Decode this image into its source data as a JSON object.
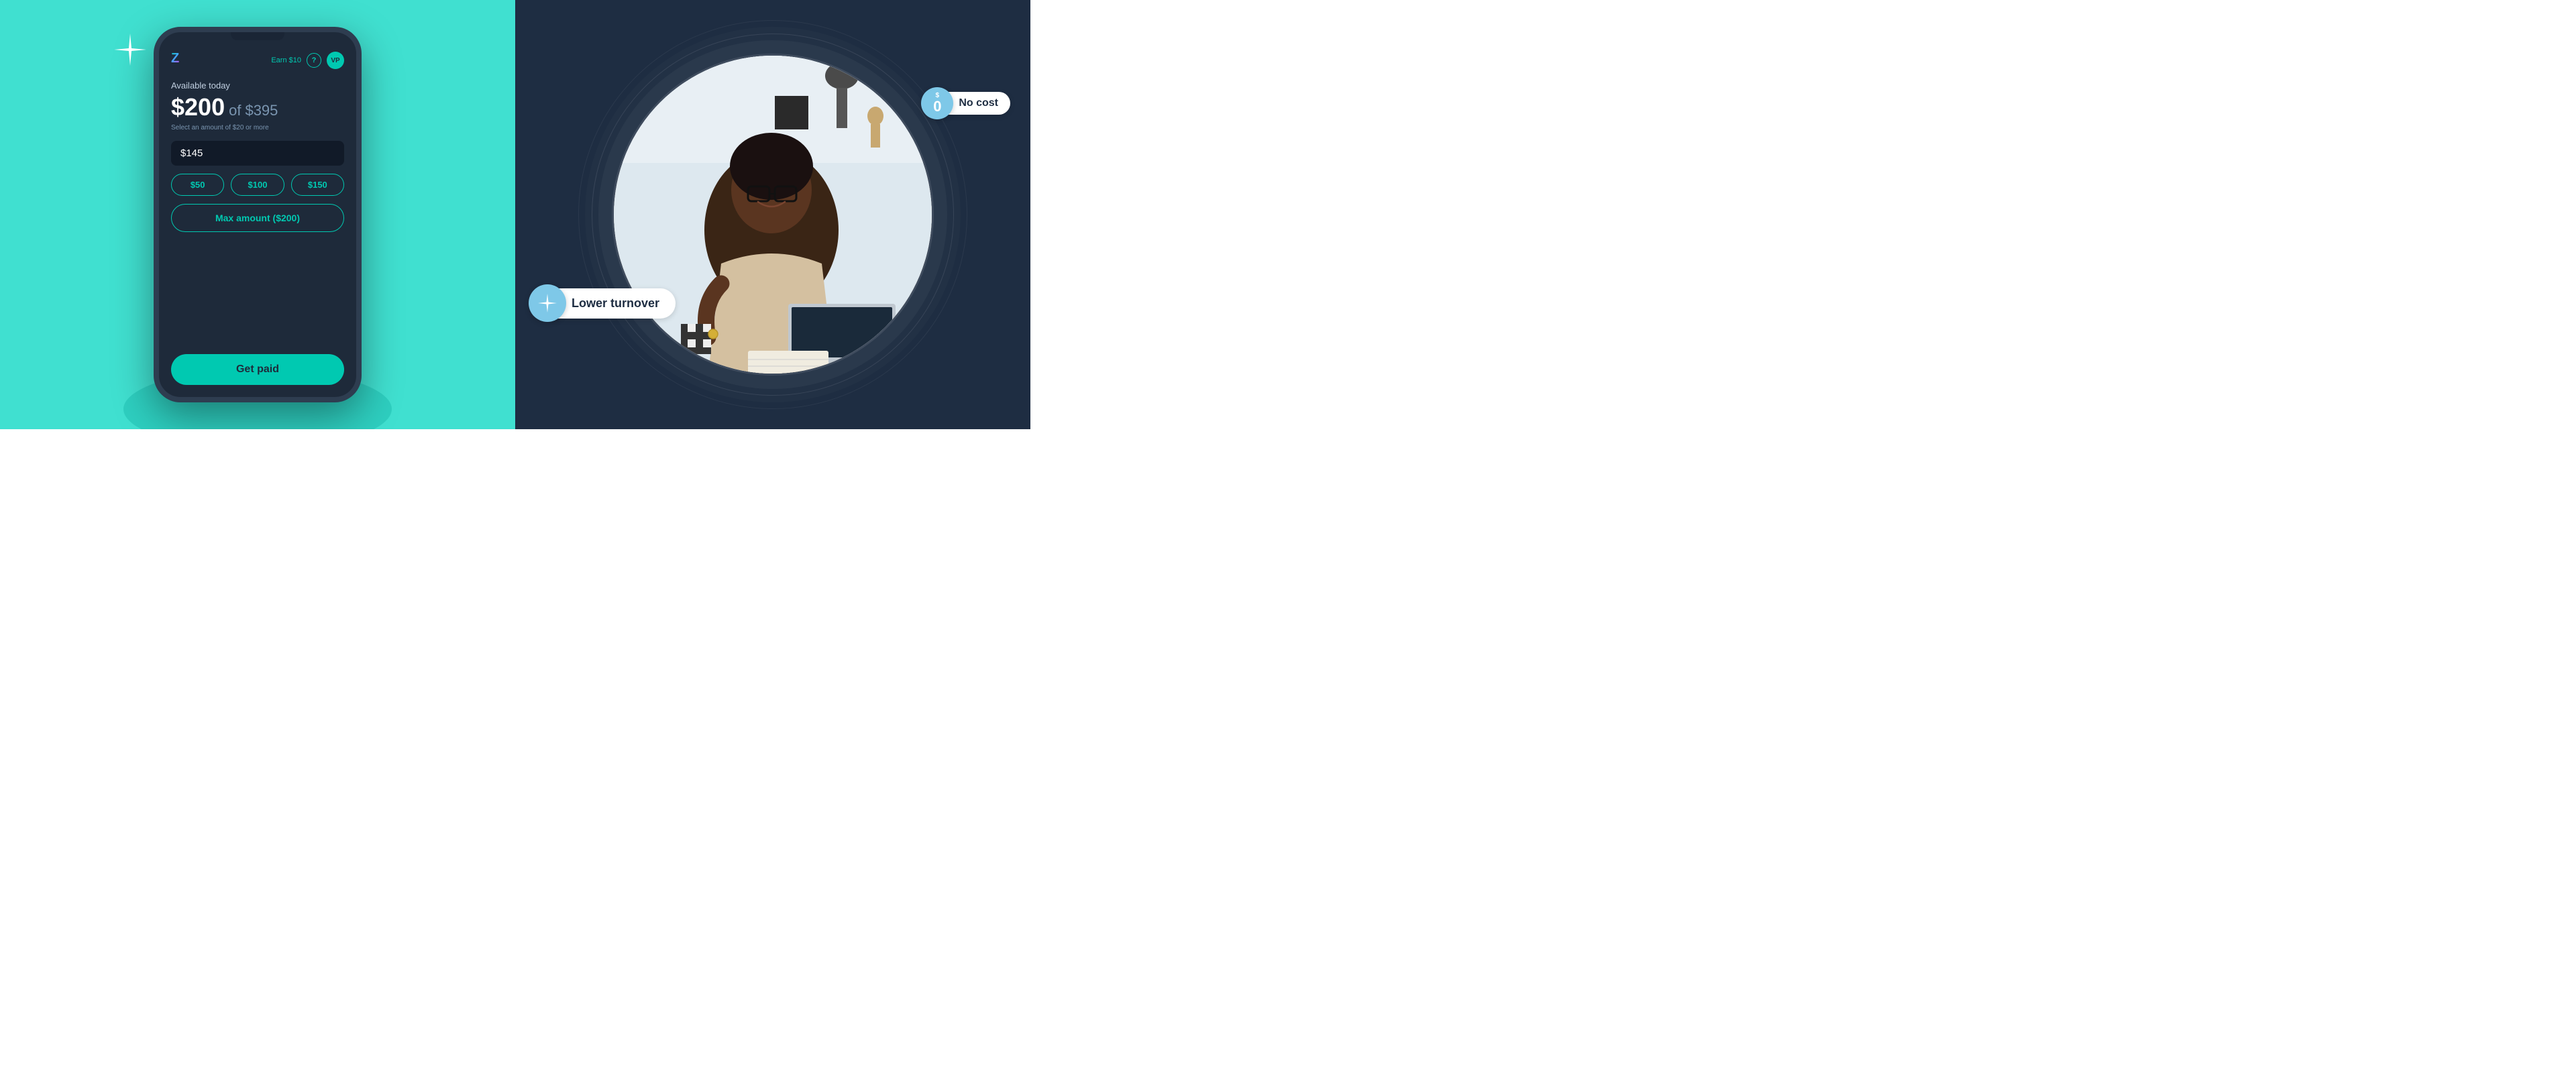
{
  "left_panel": {
    "bg_color": "#40E0D0",
    "phone": {
      "logo_text": "Z",
      "earn_label": "Earn $10",
      "help_label": "?",
      "avatar_initials": "VP",
      "available_label": "Available today",
      "amount_main": "$200",
      "amount_separator": "of",
      "amount_total": "$395",
      "select_hint": "Select an amount of $20 or more",
      "input_value": "$145",
      "quick_amounts": [
        "$50",
        "$100",
        "$150"
      ],
      "max_btn_label": "Max amount ($200)",
      "get_paid_label": "Get paid"
    }
  },
  "right_panel": {
    "bg_color": "#1e2d42",
    "no_cost_badge": {
      "dollar_super": "$",
      "dollar_amount": "0",
      "text": "No cost"
    },
    "lower_turnover_badge": {
      "text": "Lower turnover"
    }
  }
}
